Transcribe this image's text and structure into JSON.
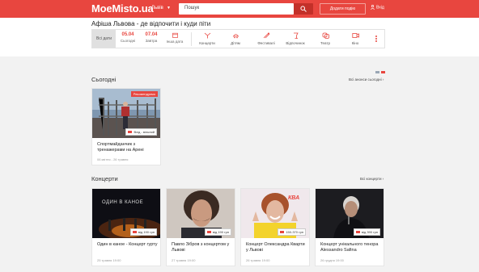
{
  "header": {
    "logo": "MoeMisto.ua",
    "city": "Львів",
    "search_placeholder": "Пошук",
    "add_event": "Додати подію",
    "login": "Вхід"
  },
  "page": {
    "title": "Афіша Львова - де відпочити і куди піти"
  },
  "filters": {
    "all_days": "Всі дати",
    "today_date": "05.04",
    "today_label": "Сьогодні",
    "tomorrow_date": "07.04",
    "tomorrow_label": "Завтра",
    "pick_date": "Інша дата",
    "categories": [
      {
        "label": "Концерти",
        "icon": "concert-icon"
      },
      {
        "label": "Дітям",
        "icon": "kids-icon"
      },
      {
        "label": "Фестивалі",
        "icon": "festival-icon"
      },
      {
        "label": "Відпочинок",
        "icon": "leisure-icon"
      },
      {
        "label": "Театр",
        "icon": "theatre-icon"
      },
      {
        "label": "Кіно",
        "icon": "cinema-icon"
      }
    ]
  },
  "today": {
    "title": "Сьогодні",
    "all_link": "Всі анонси сьогодні ›",
    "card": {
      "badge": "Рекомендуємо",
      "price": "Вхід - вільний",
      "title": "Спортмайданчик з тренажерами на Арені",
      "date": "06 квітня - 26 травня"
    }
  },
  "concerts": {
    "title": "Концерти",
    "all_link": "Всі концерти ›",
    "cards": [
      {
        "title": "Один в каное - Концерт гурту",
        "price": "від 190 грн",
        "date": "25 травня 19:00",
        "poster_text": "ОДИН В КАНОЕ"
      },
      {
        "title": "Павло Зібров з концертом у Львові",
        "price": "від 190 грн",
        "date": "27 травня 19:00"
      },
      {
        "title": "Концерт Олександра Кварти у Львові",
        "price": "150-370 грн",
        "date": "26 травня 19:00",
        "poster_text": "КВА"
      },
      {
        "title": "Концерт унікального тенора Alessandro Safina",
        "price": "від 390 грн",
        "date": "26 грудня 19:00"
      }
    ]
  }
}
